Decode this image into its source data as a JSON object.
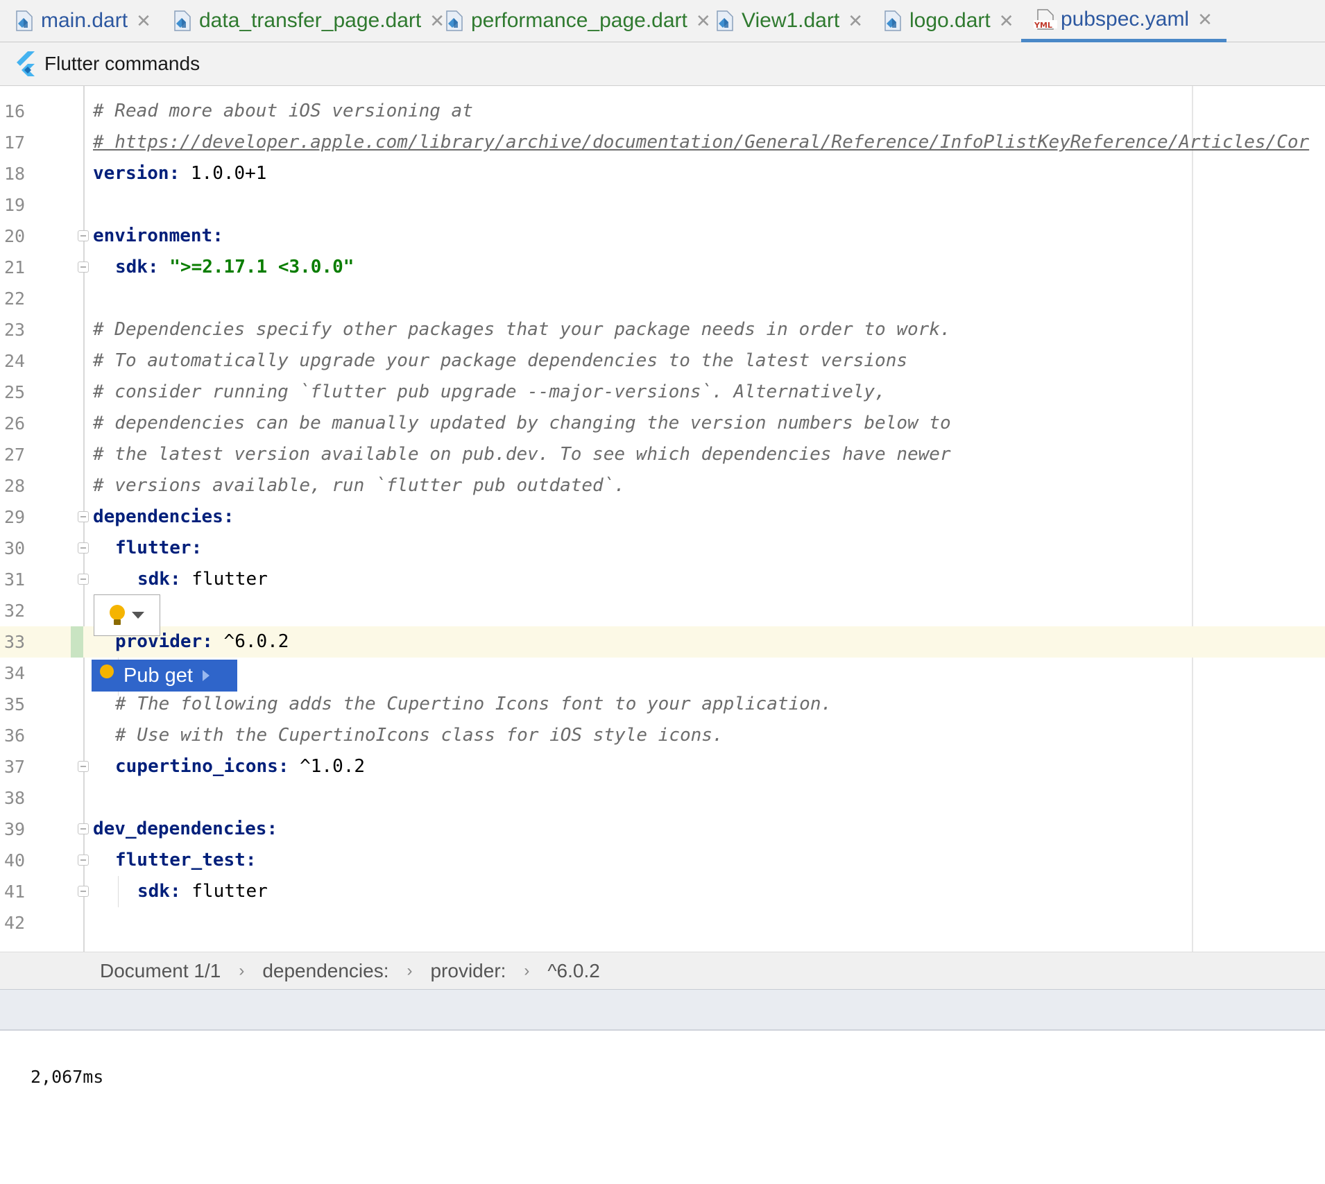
{
  "tabs": [
    {
      "label": "main.dart",
      "icon": "dart-file-icon",
      "active": false
    },
    {
      "label": "data_transfer_page.dart",
      "icon": "dart-file-icon",
      "active": false
    },
    {
      "label": "performance_page.dart",
      "icon": "dart-file-icon",
      "active": false
    },
    {
      "label": "View1.dart",
      "icon": "dart-file-icon",
      "active": false
    },
    {
      "label": "logo.dart",
      "icon": "dart-file-icon",
      "active": false
    },
    {
      "label": "pubspec.yaml",
      "icon": "yaml-file-icon",
      "active": true
    }
  ],
  "tab_close_glyph": "✕",
  "toolbar": {
    "flutter_commands_label": "Flutter commands",
    "icon": "flutter-logo-icon"
  },
  "editor": {
    "lines": {
      "l16": {
        "num": "16",
        "text": "# Read more about iOS versioning at"
      },
      "l17": {
        "num": "17",
        "text": "# https://developer.apple.com/library/archive/documentation/General/Reference/InfoPlistKeyReference/Articles/Cor"
      },
      "l18": {
        "num": "18",
        "key": "version",
        "value": " 1.0.0+1"
      },
      "l19": {
        "num": "19"
      },
      "l20": {
        "num": "20",
        "key": "environment"
      },
      "l21": {
        "num": "21",
        "key": "sdk",
        "value": "\">=2.17.1 <3.0.0\""
      },
      "l22": {
        "num": "22"
      },
      "l23": {
        "num": "23",
        "text": "# Dependencies specify other packages that your package needs in order to work."
      },
      "l24": {
        "num": "24",
        "text": "# To automatically upgrade your package dependencies to the latest versions"
      },
      "l25": {
        "num": "25",
        "text": "# consider running `flutter pub upgrade --major-versions`. Alternatively,"
      },
      "l26": {
        "num": "26",
        "text": "# dependencies can be manually updated by changing the version numbers below to"
      },
      "l27": {
        "num": "27",
        "text": "# the latest version available on pub.dev. To see which dependencies have newer"
      },
      "l28": {
        "num": "28",
        "text": "# versions available, run `flutter pub outdated`."
      },
      "l29": {
        "num": "29",
        "key": "dependencies"
      },
      "l30": {
        "num": "30",
        "key": "flutter"
      },
      "l31": {
        "num": "31",
        "key": "sdk",
        "value": " flutter"
      },
      "l32": {
        "num": "32"
      },
      "l33": {
        "num": "33",
        "key": "provider",
        "value": " ^6.0.2"
      },
      "l34": {
        "num": "34"
      },
      "l35": {
        "num": "35",
        "text": "# The following adds the Cupertino Icons font to your application."
      },
      "l36": {
        "num": "36",
        "text": "# Use with the CupertinoIcons class for iOS style icons."
      },
      "l37": {
        "num": "37",
        "key": "cupertino_icons",
        "value": " ^1.0.2"
      },
      "l38": {
        "num": "38"
      },
      "l39": {
        "num": "39",
        "key": "dev_dependencies"
      },
      "l40": {
        "num": "40",
        "key": "flutter_test"
      },
      "l41": {
        "num": "41",
        "key": "sdk",
        "value": " flutter"
      },
      "l42": {
        "num": "42"
      }
    },
    "colon": ":",
    "intention_popup": {
      "label": "Pub get",
      "icon": "lightbulb-icon"
    }
  },
  "breadcrumb": [
    "Document 1/1",
    "dependencies:",
    "provider:",
    "^6.0.2"
  ],
  "breadcrumb_sep": "›",
  "output": {
    "timing": "2,067ms"
  },
  "colors": {
    "accent": "#2f65ca",
    "current_line": "#fcf9e6",
    "key": "#001f7a",
    "string": "#0a7d00",
    "bulb": "#f5b400"
  }
}
